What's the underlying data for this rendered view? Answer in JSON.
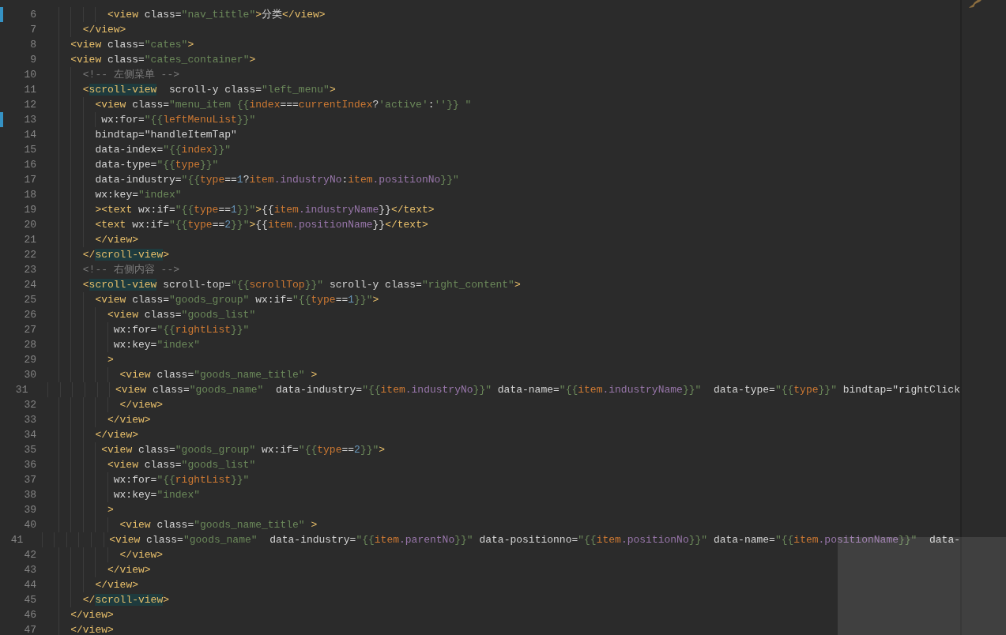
{
  "editor": {
    "lines": [
      {
        "number": "6",
        "modified": true,
        "tokens": [
          {
            "kind": "tag",
            "text": "          <view"
          },
          {
            "kind": "attr",
            "text": " class="
          },
          {
            "kind": "str",
            "text": "\"nav_tittle\""
          },
          {
            "kind": "tag",
            "text": ">"
          },
          {
            "kind": "txt",
            "text": "分类"
          },
          {
            "kind": "tag",
            "text": "</view>"
          }
        ]
      },
      {
        "number": "7",
        "modified": false,
        "tokens": [
          {
            "kind": "tag",
            "text": "      </view>"
          }
        ]
      },
      {
        "number": "8",
        "modified": false,
        "tokens": [
          {
            "kind": "tag",
            "text": "    <view"
          },
          {
            "kind": "attr",
            "text": " class="
          },
          {
            "kind": "str",
            "text": "\"cates\""
          },
          {
            "kind": "tag",
            "text": ">"
          }
        ]
      },
      {
        "number": "9",
        "modified": false,
        "tokens": [
          {
            "kind": "tag",
            "text": "    <view"
          },
          {
            "kind": "attr",
            "text": " class="
          },
          {
            "kind": "str",
            "text": "\"cates_container\""
          },
          {
            "kind": "tag",
            "text": ">"
          }
        ]
      },
      {
        "number": "10",
        "modified": false,
        "tokens": [
          {
            "kind": "cmt",
            "text": "      <!-- 左侧菜单 -->"
          }
        ]
      },
      {
        "number": "11",
        "modified": false,
        "tokens": [
          {
            "kind": "tag",
            "text": "      <"
          },
          {
            "kind": "match",
            "text": "scroll-view"
          },
          {
            "kind": "attr",
            "text": "  scroll-y class="
          },
          {
            "kind": "str",
            "text": "\"left_menu\""
          },
          {
            "kind": "tag",
            "text": ">"
          }
        ]
      },
      {
        "number": "12",
        "modified": false,
        "tokens": [
          {
            "kind": "tag",
            "text": "        <view"
          },
          {
            "kind": "attr",
            "text": " class="
          },
          {
            "kind": "str",
            "text": "\"menu_item {{"
          },
          {
            "kind": "var",
            "text": "index"
          },
          {
            "kind": "op",
            "text": "==="
          },
          {
            "kind": "var",
            "text": "currentIndex"
          },
          {
            "kind": "op",
            "text": "?"
          },
          {
            "kind": "str",
            "text": "'active'"
          },
          {
            "kind": "op",
            "text": ":"
          },
          {
            "kind": "str",
            "text": "''"
          },
          {
            "kind": "str",
            "text": "}} \""
          }
        ]
      },
      {
        "number": "13",
        "modified": true,
        "tokens": [
          {
            "kind": "attr",
            "text": "         wx:for="
          },
          {
            "kind": "str",
            "text": "\"{{"
          },
          {
            "kind": "var",
            "text": "leftMenuList"
          },
          {
            "kind": "str",
            "text": "}}\""
          }
        ]
      },
      {
        "number": "14",
        "modified": false,
        "tokens": [
          {
            "kind": "attr",
            "text": "        bindtap="
          },
          {
            "kind": "txt",
            "text": "\"handleItemTap\""
          }
        ]
      },
      {
        "number": "15",
        "modified": false,
        "tokens": [
          {
            "kind": "attr",
            "text": "        data-index="
          },
          {
            "kind": "str",
            "text": "\"{{"
          },
          {
            "kind": "var",
            "text": "index"
          },
          {
            "kind": "str",
            "text": "}}\""
          }
        ]
      },
      {
        "number": "16",
        "modified": false,
        "tokens": [
          {
            "kind": "attr",
            "text": "        data-type="
          },
          {
            "kind": "str",
            "text": "\"{{"
          },
          {
            "kind": "var",
            "text": "type"
          },
          {
            "kind": "str",
            "text": "}}\""
          }
        ]
      },
      {
        "number": "17",
        "modified": false,
        "tokens": [
          {
            "kind": "attr",
            "text": "        data-industry="
          },
          {
            "kind": "str",
            "text": "\"{{"
          },
          {
            "kind": "var",
            "text": "type"
          },
          {
            "kind": "op",
            "text": "=="
          },
          {
            "kind": "num",
            "text": "1"
          },
          {
            "kind": "op",
            "text": "?"
          },
          {
            "kind": "var",
            "text": "item"
          },
          {
            "kind": "prop",
            "text": ".industryNo"
          },
          {
            "kind": "op",
            "text": ":"
          },
          {
            "kind": "var",
            "text": "item"
          },
          {
            "kind": "prop",
            "text": ".positionNo"
          },
          {
            "kind": "str",
            "text": "}}\""
          }
        ]
      },
      {
        "number": "18",
        "modified": false,
        "tokens": [
          {
            "kind": "attr",
            "text": "        wx:key="
          },
          {
            "kind": "str",
            "text": "\"index\""
          }
        ]
      },
      {
        "number": "19",
        "modified": false,
        "tokens": [
          {
            "kind": "tag",
            "text": "        ><text"
          },
          {
            "kind": "attr",
            "text": " wx:if="
          },
          {
            "kind": "str",
            "text": "\"{{"
          },
          {
            "kind": "var",
            "text": "type"
          },
          {
            "kind": "op",
            "text": "=="
          },
          {
            "kind": "num",
            "text": "1"
          },
          {
            "kind": "str",
            "text": "}}\""
          },
          {
            "kind": "tag",
            "text": ">"
          },
          {
            "kind": "txt",
            "text": "{{"
          },
          {
            "kind": "var",
            "text": "item"
          },
          {
            "kind": "prop",
            "text": ".industryName"
          },
          {
            "kind": "txt",
            "text": "}}"
          },
          {
            "kind": "tag",
            "text": "</text>"
          }
        ]
      },
      {
        "number": "20",
        "modified": false,
        "tokens": [
          {
            "kind": "tag",
            "text": "        <text"
          },
          {
            "kind": "attr",
            "text": " wx:if="
          },
          {
            "kind": "str",
            "text": "\"{{"
          },
          {
            "kind": "var",
            "text": "type"
          },
          {
            "kind": "op",
            "text": "=="
          },
          {
            "kind": "num",
            "text": "2"
          },
          {
            "kind": "str",
            "text": "}}\""
          },
          {
            "kind": "tag",
            "text": ">"
          },
          {
            "kind": "txt",
            "text": "{{"
          },
          {
            "kind": "var",
            "text": "item"
          },
          {
            "kind": "prop",
            "text": ".positionName"
          },
          {
            "kind": "txt",
            "text": "}}"
          },
          {
            "kind": "tag",
            "text": "</text>"
          }
        ]
      },
      {
        "number": "21",
        "modified": false,
        "tokens": [
          {
            "kind": "tag",
            "text": "        </view>"
          }
        ]
      },
      {
        "number": "22",
        "modified": false,
        "tokens": [
          {
            "kind": "tag",
            "text": "      </"
          },
          {
            "kind": "match",
            "text": "scroll-view"
          },
          {
            "kind": "tag",
            "text": ">"
          }
        ]
      },
      {
        "number": "23",
        "modified": false,
        "tokens": [
          {
            "kind": "cmt",
            "text": "      <!-- 右侧内容 -->"
          }
        ]
      },
      {
        "number": "24",
        "modified": false,
        "tokens": [
          {
            "kind": "tag",
            "text": "      <"
          },
          {
            "kind": "match",
            "text": "scroll-view"
          },
          {
            "kind": "attr",
            "text": " scroll-top="
          },
          {
            "kind": "str",
            "text": "\"{{"
          },
          {
            "kind": "var",
            "text": "scrollTop"
          },
          {
            "kind": "str",
            "text": "}}\""
          },
          {
            "kind": "attr",
            "text": " scroll-y class="
          },
          {
            "kind": "str",
            "text": "\"right_content\""
          },
          {
            "kind": "tag",
            "text": ">"
          }
        ]
      },
      {
        "number": "25",
        "modified": false,
        "tokens": [
          {
            "kind": "tag",
            "text": "        <view"
          },
          {
            "kind": "attr",
            "text": " class="
          },
          {
            "kind": "str",
            "text": "\"goods_group\""
          },
          {
            "kind": "attr",
            "text": " wx:if="
          },
          {
            "kind": "str",
            "text": "\"{{"
          },
          {
            "kind": "var",
            "text": "type"
          },
          {
            "kind": "op",
            "text": "=="
          },
          {
            "kind": "num",
            "text": "1"
          },
          {
            "kind": "str",
            "text": "}}\""
          },
          {
            "kind": "tag",
            "text": ">"
          }
        ]
      },
      {
        "number": "26",
        "modified": false,
        "tokens": [
          {
            "kind": "tag",
            "text": "          <view"
          },
          {
            "kind": "attr",
            "text": " class="
          },
          {
            "kind": "str",
            "text": "\"goods_list\""
          }
        ]
      },
      {
        "number": "27",
        "modified": false,
        "tokens": [
          {
            "kind": "attr",
            "text": "           wx:for="
          },
          {
            "kind": "str",
            "text": "\"{{"
          },
          {
            "kind": "var",
            "text": "rightList"
          },
          {
            "kind": "str",
            "text": "}}\""
          }
        ]
      },
      {
        "number": "28",
        "modified": false,
        "tokens": [
          {
            "kind": "attr",
            "text": "           wx:key="
          },
          {
            "kind": "str",
            "text": "\"index\""
          }
        ]
      },
      {
        "number": "29",
        "modified": false,
        "tokens": [
          {
            "kind": "tag",
            "text": "          >"
          }
        ]
      },
      {
        "number": "30",
        "modified": false,
        "tokens": [
          {
            "kind": "tag",
            "text": "            <view"
          },
          {
            "kind": "attr",
            "text": " class="
          },
          {
            "kind": "str",
            "text": "\"goods_name_title\""
          },
          {
            "kind": "tag",
            "text": " >"
          }
        ]
      },
      {
        "number": "31",
        "modified": false,
        "tokens": [
          {
            "kind": "tag",
            "text": "             <view"
          },
          {
            "kind": "attr",
            "text": " class="
          },
          {
            "kind": "str",
            "text": "\"goods_name\""
          },
          {
            "kind": "attr",
            "text": "  data-industry="
          },
          {
            "kind": "str",
            "text": "\"{{"
          },
          {
            "kind": "var",
            "text": "item"
          },
          {
            "kind": "prop",
            "text": ".industryNo"
          },
          {
            "kind": "str",
            "text": "}}\""
          },
          {
            "kind": "attr",
            "text": " data-name="
          },
          {
            "kind": "str",
            "text": "\"{{"
          },
          {
            "kind": "var",
            "text": "item"
          },
          {
            "kind": "prop",
            "text": ".industryName"
          },
          {
            "kind": "str",
            "text": "}}\""
          },
          {
            "kind": "attr",
            "text": "  data-type="
          },
          {
            "kind": "str",
            "text": "\"{{"
          },
          {
            "kind": "var",
            "text": "type"
          },
          {
            "kind": "str",
            "text": "}}\""
          },
          {
            "kind": "attr",
            "text": " bindtap="
          },
          {
            "kind": "txt",
            "text": "\"rightClick"
          }
        ]
      },
      {
        "number": "32",
        "modified": false,
        "tokens": [
          {
            "kind": "tag",
            "text": "            </view>"
          }
        ]
      },
      {
        "number": "33",
        "modified": false,
        "tokens": [
          {
            "kind": "tag",
            "text": "          </view>"
          }
        ]
      },
      {
        "number": "34",
        "modified": false,
        "tokens": [
          {
            "kind": "tag",
            "text": "        </view>"
          }
        ]
      },
      {
        "number": "35",
        "modified": false,
        "tokens": [
          {
            "kind": "tag",
            "text": "         <view"
          },
          {
            "kind": "attr",
            "text": " class="
          },
          {
            "kind": "str",
            "text": "\"goods_group\""
          },
          {
            "kind": "attr",
            "text": " wx:if="
          },
          {
            "kind": "str",
            "text": "\"{{"
          },
          {
            "kind": "var",
            "text": "type"
          },
          {
            "kind": "op",
            "text": "=="
          },
          {
            "kind": "num",
            "text": "2"
          },
          {
            "kind": "str",
            "text": "}}\""
          },
          {
            "kind": "tag",
            "text": ">"
          }
        ]
      },
      {
        "number": "36",
        "modified": false,
        "tokens": [
          {
            "kind": "tag",
            "text": "          <view"
          },
          {
            "kind": "attr",
            "text": " class="
          },
          {
            "kind": "str",
            "text": "\"goods_list\""
          }
        ]
      },
      {
        "number": "37",
        "modified": false,
        "tokens": [
          {
            "kind": "attr",
            "text": "           wx:for="
          },
          {
            "kind": "str",
            "text": "\"{{"
          },
          {
            "kind": "var",
            "text": "rightList"
          },
          {
            "kind": "str",
            "text": "}}\""
          }
        ]
      },
      {
        "number": "38",
        "modified": false,
        "tokens": [
          {
            "kind": "attr",
            "text": "           wx:key="
          },
          {
            "kind": "str",
            "text": "\"index\""
          }
        ]
      },
      {
        "number": "39",
        "modified": false,
        "tokens": [
          {
            "kind": "tag",
            "text": "          >"
          }
        ]
      },
      {
        "number": "40",
        "modified": false,
        "tokens": [
          {
            "kind": "tag",
            "text": "            <view"
          },
          {
            "kind": "attr",
            "text": " class="
          },
          {
            "kind": "str",
            "text": "\"goods_name_title\""
          },
          {
            "kind": "tag",
            "text": " >"
          }
        ]
      },
      {
        "number": "41",
        "modified": false,
        "tokens": [
          {
            "kind": "tag",
            "text": "             <view"
          },
          {
            "kind": "attr",
            "text": " class="
          },
          {
            "kind": "str",
            "text": "\"goods_name\""
          },
          {
            "kind": "attr",
            "text": "  data-industry="
          },
          {
            "kind": "str",
            "text": "\"{{"
          },
          {
            "kind": "var",
            "text": "item"
          },
          {
            "kind": "prop",
            "text": ".parentNo"
          },
          {
            "kind": "str",
            "text": "}}\""
          },
          {
            "kind": "attr",
            "text": " data-positionno="
          },
          {
            "kind": "str",
            "text": "\"{{"
          },
          {
            "kind": "var",
            "text": "item"
          },
          {
            "kind": "prop",
            "text": ".positionNo"
          },
          {
            "kind": "str",
            "text": "}}\""
          },
          {
            "kind": "attr",
            "text": " data-name="
          },
          {
            "kind": "str",
            "text": "\"{{"
          },
          {
            "kind": "var",
            "text": "item"
          },
          {
            "kind": "prop",
            "text": ".positionName"
          },
          {
            "kind": "str",
            "text": "}}\""
          },
          {
            "kind": "attr",
            "text": "  data-"
          }
        ]
      },
      {
        "number": "42",
        "modified": false,
        "tokens": [
          {
            "kind": "tag",
            "text": "            </view>"
          }
        ]
      },
      {
        "number": "43",
        "modified": false,
        "tokens": [
          {
            "kind": "tag",
            "text": "          </view>"
          }
        ]
      },
      {
        "number": "44",
        "modified": false,
        "tokens": [
          {
            "kind": "tag",
            "text": "        </view>"
          }
        ]
      },
      {
        "number": "45",
        "modified": false,
        "tokens": [
          {
            "kind": "tag",
            "text": "      </"
          },
          {
            "kind": "match",
            "text": "scroll-view"
          },
          {
            "kind": "tag",
            "text": ">"
          }
        ]
      },
      {
        "number": "46",
        "modified": false,
        "tokens": [
          {
            "kind": "tag",
            "text": "    </view>"
          }
        ]
      },
      {
        "number": "47",
        "modified": false,
        "tokens": [
          {
            "kind": "tag",
            "text": "    </view>"
          }
        ]
      }
    ]
  }
}
